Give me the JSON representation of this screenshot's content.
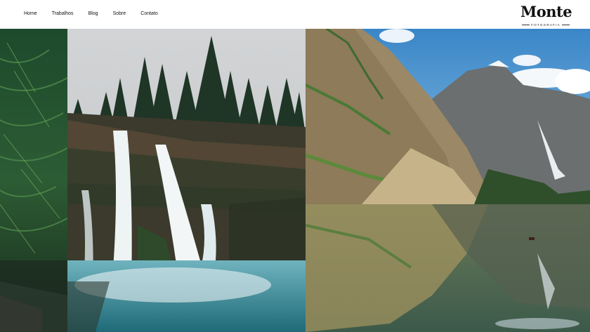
{
  "nav": {
    "items": [
      "Home",
      "Trabalhos",
      "Blog",
      "Sobre",
      "Contato"
    ]
  },
  "brand": {
    "name": "Monte",
    "tagline": "FOTOGRAFIA"
  },
  "gallery": {
    "photos": [
      {
        "subject": "forest ferns"
      },
      {
        "subject": "waterfall"
      },
      {
        "subject": "mountain lake"
      }
    ]
  }
}
